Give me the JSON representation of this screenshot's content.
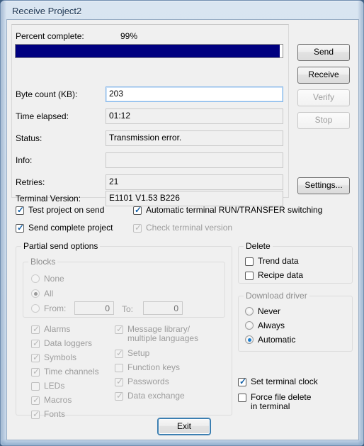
{
  "window": {
    "title": "Receive Project2"
  },
  "progress": {
    "label": "Percent complete:",
    "value_text": "99%",
    "percent": 99
  },
  "fields": [
    {
      "label": "Byte count (KB):",
      "value": "203",
      "readonly": false,
      "focused": true
    },
    {
      "label": "Time elapsed:",
      "value": "01:12",
      "readonly": true,
      "focused": false
    },
    {
      "label": "Status:",
      "value": "Transmission error.",
      "readonly": true,
      "focused": false
    },
    {
      "label": "Info:",
      "value": "",
      "readonly": true,
      "focused": false
    },
    {
      "label": "Retries:",
      "value": "21",
      "readonly": true,
      "focused": false
    },
    {
      "label": "Terminal Version:",
      "value": "E1101 V1.53 B226",
      "readonly": true,
      "focused": false
    }
  ],
  "side_buttons": [
    {
      "label": "Send",
      "enabled": true
    },
    {
      "label": "Receive",
      "enabled": true
    },
    {
      "label": "Verify",
      "enabled": false
    },
    {
      "label": "Stop",
      "enabled": false
    },
    {
      "label": "Settings...",
      "enabled": true
    }
  ],
  "top_checkboxes": [
    {
      "label": "Test project on send",
      "checked": true,
      "enabled": true
    },
    {
      "label": "Automatic terminal RUN/TRANSFER switching",
      "checked": true,
      "enabled": true
    },
    {
      "label": "Send complete project",
      "checked": true,
      "enabled": true
    },
    {
      "label": "Check terminal version",
      "checked": true,
      "enabled": false
    }
  ],
  "partial_send": {
    "title": "Partial send options",
    "blocks": {
      "title": "Blocks",
      "options": [
        {
          "label": "None",
          "selected": false,
          "enabled": false
        },
        {
          "label": "All",
          "selected": true,
          "enabled": false
        }
      ],
      "range": {
        "radio_label": "From:",
        "from_value": "0",
        "to_label": "To:",
        "to_value": "0",
        "selected": false,
        "enabled": false
      }
    },
    "items_left": [
      {
        "label": "Alarms",
        "checked": true,
        "enabled": false
      },
      {
        "label": "Data loggers",
        "checked": true,
        "enabled": false
      },
      {
        "label": "Symbols",
        "checked": true,
        "enabled": false
      },
      {
        "label": "Time channels",
        "checked": true,
        "enabled": false
      },
      {
        "label": "LEDs",
        "checked": false,
        "enabled": false
      },
      {
        "label": "Macros",
        "checked": true,
        "enabled": false
      },
      {
        "label": "Fonts",
        "checked": true,
        "enabled": false
      }
    ],
    "items_right": [
      {
        "label": "Message library/\nmultiple languages",
        "checked": true,
        "enabled": false
      },
      {
        "label": "Setup",
        "checked": true,
        "enabled": false
      },
      {
        "label": "Function keys",
        "checked": false,
        "enabled": false
      },
      {
        "label": "Passwords",
        "checked": true,
        "enabled": false
      },
      {
        "label": "Data exchange",
        "checked": true,
        "enabled": false
      }
    ]
  },
  "delete_group": {
    "title": "Delete",
    "items": [
      {
        "label": "Trend data",
        "checked": false,
        "enabled": true
      },
      {
        "label": "Recipe data",
        "checked": false,
        "enabled": true
      }
    ]
  },
  "download_driver": {
    "title": "Download driver",
    "options": [
      {
        "label": "Never",
        "selected": false,
        "enabled": true
      },
      {
        "label": "Always",
        "selected": false,
        "enabled": true
      },
      {
        "label": "Automatic",
        "selected": true,
        "enabled": true
      }
    ]
  },
  "bottom_checkboxes": [
    {
      "label": "Set terminal clock",
      "checked": true,
      "enabled": true
    },
    {
      "label": "Force file delete\nin terminal",
      "checked": false,
      "enabled": true
    }
  ],
  "exit_button": {
    "label": "Exit",
    "focused": true
  },
  "colors": {
    "progress_fill": "#000080",
    "accent": "#1d7fd0",
    "focus_ring": "#3c7fb1",
    "dialog_bg": "#f0f0f0",
    "title_text": "#18324f"
  }
}
